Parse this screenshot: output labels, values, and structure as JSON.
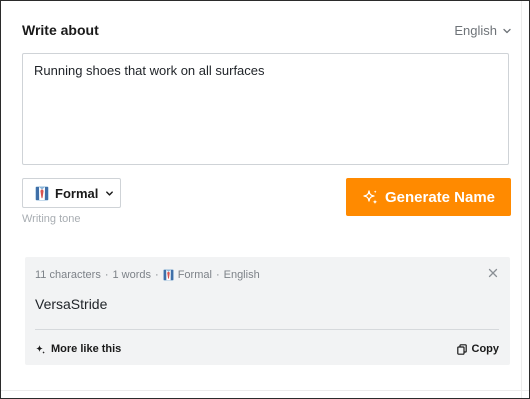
{
  "header": {
    "title": "Write about",
    "language": "English"
  },
  "input": {
    "value": "Running shoes that work on all surfaces"
  },
  "tone": {
    "selected": "Formal",
    "label": "Writing tone",
    "icon": "necktie-emoji"
  },
  "generate": {
    "label": "Generate Name",
    "icon": "sparkles-icon"
  },
  "result": {
    "characters": "11 characters",
    "sep1": "·",
    "words": "1 words",
    "sep2": "·",
    "tone": "Formal",
    "sep3": "·",
    "language": "English",
    "name": "VersaStride",
    "more_label": "More like this",
    "copy_label": "Copy"
  },
  "colors": {
    "accent": "#ff8a00",
    "card_bg": "#f2f3f4",
    "border": "#cfd3d7"
  }
}
